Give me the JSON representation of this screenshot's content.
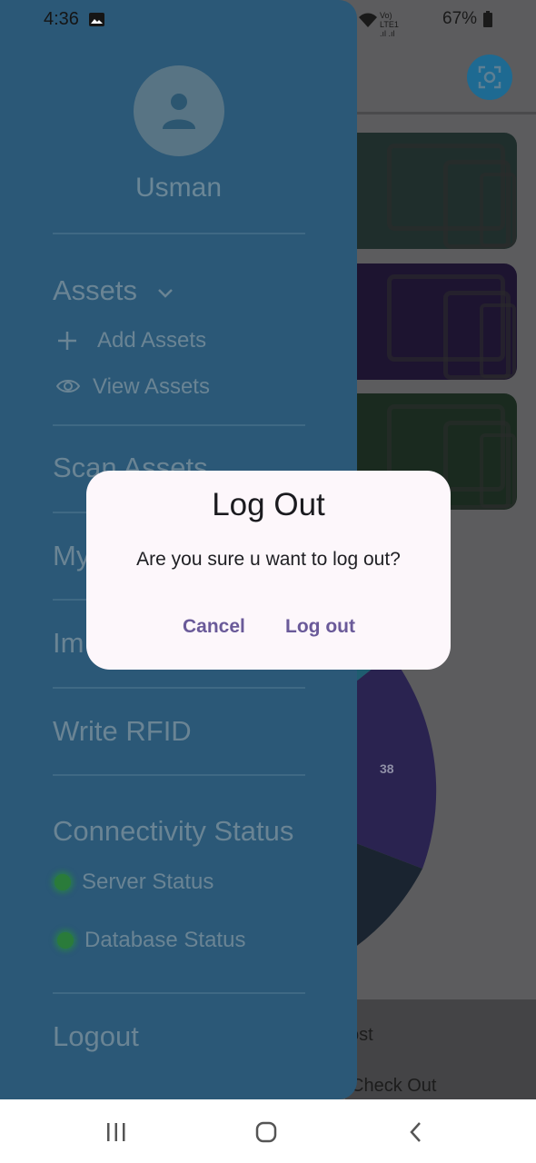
{
  "status_bar": {
    "time": "4:36",
    "indicators": "Vo) LTE1 .ıl .ıl",
    "battery": "67%"
  },
  "background": {
    "pie_value": "38",
    "list_items": [
      "ost",
      "Check Out"
    ]
  },
  "drawer": {
    "username": "Usman",
    "assets_header": "Assets",
    "add_assets": "Add Assets",
    "view_assets": "View Assets",
    "scan_assets": "Scan Assets",
    "my_item": "My",
    "im_item": "Im",
    "write_rfid": "Write RFID",
    "connectivity_header": "Connectivity Status",
    "server_status": "Server Status",
    "database_status": "Database Status",
    "logout": "Logout",
    "status_color": "#2a7b3a"
  },
  "dialog": {
    "title": "Log Out",
    "message": "Are you sure u want to log out?",
    "cancel": "Cancel",
    "confirm": "Log out"
  },
  "colors": {
    "drawer": "#2b5877",
    "dialog": "#fdf7fb",
    "accent": "#6a5a99"
  }
}
